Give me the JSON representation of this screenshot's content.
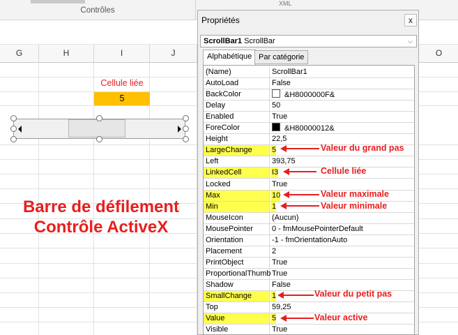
{
  "ribbon": {
    "group_label": "Contrôles",
    "tab_label": "XML"
  },
  "columns": [
    "G",
    "H",
    "I",
    "J",
    "O"
  ],
  "sheet": {
    "linked_label": "Cellule liée",
    "linked_value": "5",
    "caption_line1": "Barre de défilement",
    "caption_line2": "Contrôle ActiveX"
  },
  "properties": {
    "title": "Propriétés",
    "close": "x",
    "object_name": "ScrollBar1",
    "object_type": "ScrollBar",
    "tabs": [
      "Alphabétique",
      "Par catégorie"
    ],
    "rows": [
      {
        "key": "(Name)",
        "value": "ScrollBar1"
      },
      {
        "key": "AutoLoad",
        "value": "False"
      },
      {
        "key": "BackColor",
        "value": "&H8000000F&",
        "swatch": "#ffffff"
      },
      {
        "key": "Delay",
        "value": "50"
      },
      {
        "key": "Enabled",
        "value": "True"
      },
      {
        "key": "ForeColor",
        "value": "&H80000012&",
        "swatch": "#000000"
      },
      {
        "key": "Height",
        "value": "22,5"
      },
      {
        "key": "LargeChange",
        "value": "5",
        "highlight": true
      },
      {
        "key": "Left",
        "value": "393,75"
      },
      {
        "key": "LinkedCell",
        "value": "I3",
        "highlight": true
      },
      {
        "key": "Locked",
        "value": "True"
      },
      {
        "key": "Max",
        "value": "10",
        "highlight": true
      },
      {
        "key": "Min",
        "value": "1",
        "highlight": true
      },
      {
        "key": "MouseIcon",
        "value": "(Aucun)"
      },
      {
        "key": "MousePointer",
        "value": "0 - fmMousePointerDefault"
      },
      {
        "key": "Orientation",
        "value": "-1 - fmOrientationAuto"
      },
      {
        "key": "Placement",
        "value": "2"
      },
      {
        "key": "PrintObject",
        "value": "True"
      },
      {
        "key": "ProportionalThumb",
        "value": "True"
      },
      {
        "key": "Shadow",
        "value": "False"
      },
      {
        "key": "SmallChange",
        "value": "1",
        "highlight": true
      },
      {
        "key": "Top",
        "value": "59,25"
      },
      {
        "key": "Value",
        "value": "5",
        "highlight": true
      },
      {
        "key": "Visible",
        "value": "True"
      }
    ]
  },
  "annotations": {
    "large_change": "Valeur du grand pas",
    "linked_cell": "Cellule liée",
    "max": "Valeur maximale",
    "min": "Valeur minimale",
    "small_change": "Valeur du petit pas",
    "value": "Valeur active"
  },
  "colors": {
    "highlight": "#ffff4d",
    "annotation": "#e81e1e",
    "linked_cell": "#ffc000"
  }
}
